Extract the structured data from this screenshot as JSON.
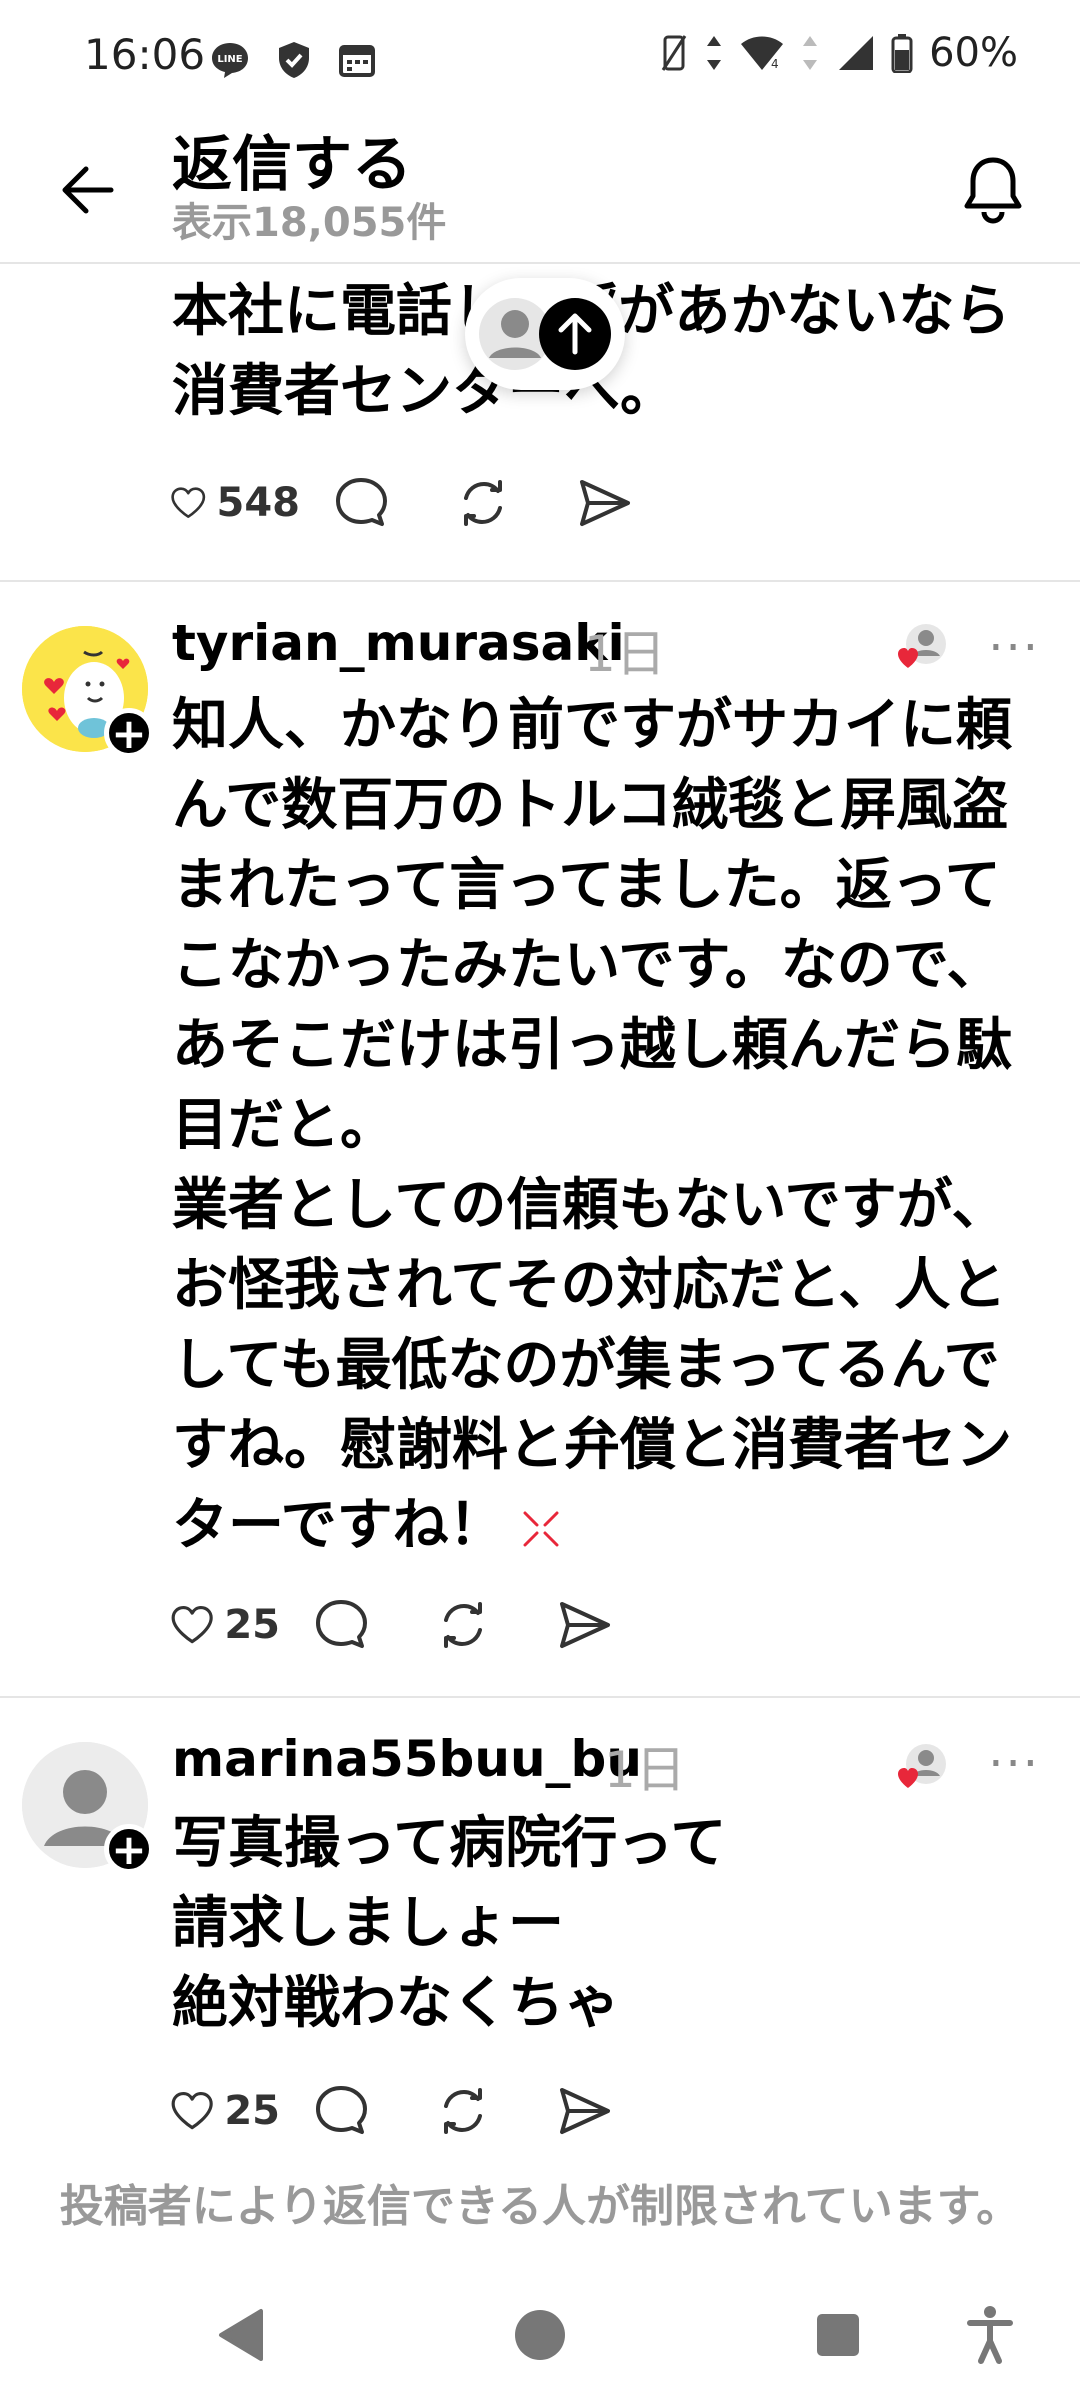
{
  "status_bar": {
    "time": "16:06",
    "battery": "60%"
  },
  "header": {
    "title": "返信する",
    "subtitle": "表示18,055件"
  },
  "top_post": {
    "body": "本社に電話して埒があかないなら\n消費者センターへ。",
    "likes": "548"
  },
  "replies": [
    {
      "username": "tyrian_murasaki",
      "time": "1日",
      "body": "知人、かなり前ですがサカイに頼\nんで数百万のトルコ絨毯と屏風盗\nまれたって言ってました。返って\nこなかったみたいです。なので、\nあそこだけは引っ越し頼んだら駄\n目だと。\n業者としての信頼もないですが、\nお怪我されてその対応だと、人と\nしても最低なのが集まってるんで\nすね。慰謝料と弁償と消費者セン\nターですね！",
      "likes": "25"
    },
    {
      "username": "marina55buu_bu",
      "time": "1日",
      "body": "写真撮って病院行って\n請求しましょー\n絶対戦わなくちゃ",
      "likes": "25"
    }
  ],
  "footer_note": "投稿者により返信できる人が制限されています。",
  "colors": {
    "accent_red": "#e8273a",
    "muted_text": "#999999"
  }
}
